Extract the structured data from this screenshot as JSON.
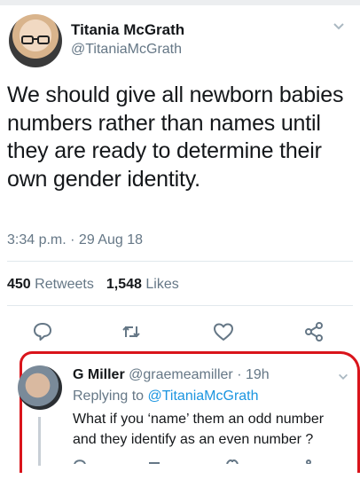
{
  "tweet": {
    "author_name": "Titania McGrath",
    "author_handle": "@TitaniaMcGrath",
    "text": "We should give all newborn babies numbers rather than names until they are ready to determine their own gender identity.",
    "time": "3:34 p.m. · 29 Aug 18",
    "retweets_count": "450",
    "retweets_label": "Retweets",
    "likes_count": "1,548",
    "likes_label": "Likes"
  },
  "reply": {
    "author_name": "G Miller",
    "author_handle": "@graemeamiller",
    "age": "· 19h",
    "replying_prefix": "Replying to",
    "replying_handle": "@TitaniaMcGrath",
    "text": "What if you ‘name’ them an odd number and they identify as an even number ?"
  },
  "icons": [
    "chevron-down-icon",
    "reply-icon",
    "retweet-icon",
    "like-icon",
    "share-icon"
  ],
  "colors": {
    "accent": "#1b95e0",
    "secondary_text": "#657786",
    "annotation_red": "#d9141b"
  }
}
